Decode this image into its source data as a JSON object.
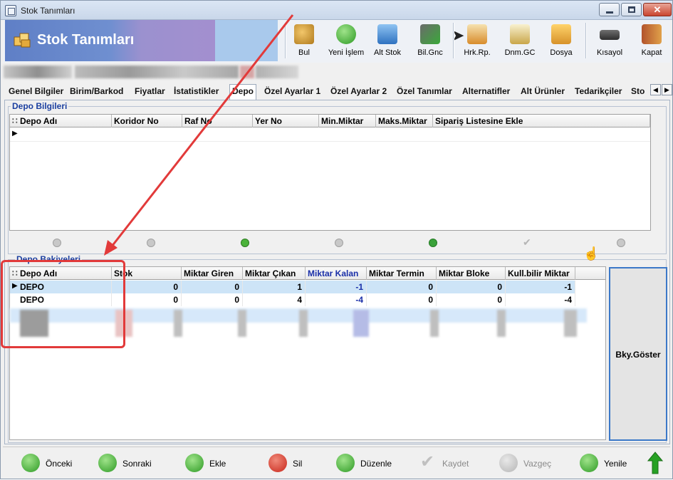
{
  "window": {
    "title": "Stok Tanımları",
    "controls": {
      "minimize": "",
      "maximize": "",
      "close": "✕"
    }
  },
  "header": {
    "title": "Stok Tanımları",
    "brand_color": "#6a88cc"
  },
  "toolbar": [
    {
      "label": "Bul",
      "icon": "search-user-icon"
    },
    {
      "label": "Yeni İşlem",
      "icon": "plus-circle-icon"
    },
    {
      "label": "Alt Stok",
      "icon": "network-icon"
    },
    {
      "label": "Bil.Gnc",
      "icon": "money-refresh-icon"
    },
    {
      "label": "Hrk.Rp.",
      "icon": "report-icon"
    },
    {
      "label": "Dnm.GC",
      "icon": "clipboard-icon"
    },
    {
      "label": "Dosya",
      "icon": "folder-icon"
    },
    {
      "label": "Kısayol",
      "icon": "keyboard-icon"
    },
    {
      "label": "Kapat",
      "icon": "exit-door-icon"
    }
  ],
  "tabs": [
    "Genel Bilgiler",
    "Birim/Barkod",
    "Fiyatlar",
    "İstatistikler",
    "Depo",
    "Özel Ayarlar 1",
    "Özel Ayarlar 2",
    "Özel Tanımlar",
    "Alternatifler",
    "Alt Ürünler",
    "Tedarikçiler",
    "Sto"
  ],
  "active_tab": "Depo",
  "depo_bilgileri": {
    "title": "Depo Bilgileri",
    "columns": [
      "Depo Adı",
      "Koridor No",
      "Raf No",
      "Yer No",
      "Min.Miktar",
      "Maks.Miktar",
      "Sipariş Listesine Ekle"
    ]
  },
  "depo_bakiyeleri": {
    "title": "Depo Bakiyeleri",
    "columns": [
      "Depo Adı",
      "Stok",
      "Miktar Giren",
      "Miktar Çıkan",
      "Miktar Kalan",
      "Miktar Termin",
      "Miktar Bloke",
      "Kull.bilir Miktar"
    ],
    "rows": [
      {
        "depo": "DEPO",
        "stok": "0",
        "giren": "0",
        "cikan": "1",
        "kalan": "-1",
        "termin": "0",
        "bloke": "0",
        "kullanilir": "-1"
      },
      {
        "depo": "DEPO",
        "stok": "0",
        "giren": "0",
        "cikan": "4",
        "kalan": "-4",
        "termin": "0",
        "bloke": "0",
        "kullanilir": "-4"
      }
    ],
    "side_button": "Bky.Göster"
  },
  "bottom_buttons": [
    {
      "label": "Önceki",
      "icon": "arrow-left-icon",
      "enabled": true
    },
    {
      "label": "Sonraki",
      "icon": "arrow-right-icon",
      "enabled": true
    },
    {
      "label": "Ekle",
      "icon": "plus-icon",
      "enabled": true
    },
    {
      "label": "Sil",
      "icon": "minus-icon",
      "enabled": true
    },
    {
      "label": "Düzenle",
      "icon": "edit-icon",
      "enabled": true
    },
    {
      "label": "Kaydet",
      "icon": "check-icon",
      "enabled": false
    },
    {
      "label": "Vazgeç",
      "icon": "cancel-icon",
      "enabled": false
    },
    {
      "label": "Yenile",
      "icon": "refresh-icon",
      "enabled": true
    }
  ],
  "colors": {
    "accent": "#1b3fa0",
    "annotation": "#e23a3a",
    "selection": "#cde4f7"
  }
}
